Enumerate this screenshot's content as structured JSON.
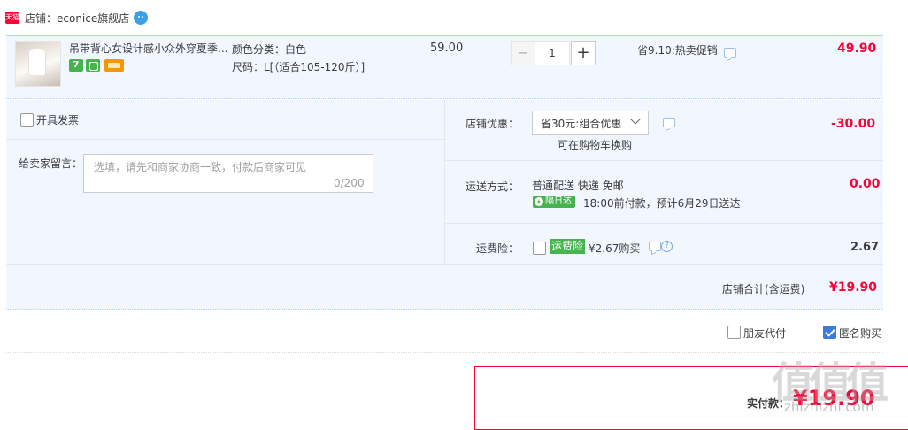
{
  "store": {
    "logo_text": "天猫",
    "name": "店铺：econice旗舰店"
  },
  "item": {
    "title": "吊带背心女设计感小众外穿夏季...",
    "badge_text": "7",
    "sku_color": "颜色分类：白色",
    "sku_size": "尺码：L[（适合105-120斤）]",
    "price": "59.00",
    "qty_minus": "−",
    "qty_value": "1",
    "qty_plus": "+",
    "promo": "省9.10:热卖促销",
    "subtotal": "49.90"
  },
  "options": {
    "invoice_label": "开具发票",
    "message_label": "给卖家留言：",
    "message_placeholder": "选填，请先和商家协商一致，付款后商家可见",
    "message_count": "0/200",
    "discount_label": "店铺优惠：",
    "discount_selected": "省30元:组合优惠",
    "discount_note": "可在购物车换购",
    "discount_amount": "-30.00",
    "shipping_label": "运送方式：",
    "shipping_method": "普通配送 快递 免邮",
    "shipping_badge": "隔日达",
    "shipping_eta": "18:00前付款，预计6月29日送达",
    "shipping_amount": "0.00",
    "insurance_label": "运费险：",
    "insurance_tag": "运费险",
    "insurance_price": "¥2.67购买",
    "insurance_amount": "2.67",
    "help_icon_text": "?",
    "store_total_label": "店铺合计(含运费)",
    "store_total": "¥19.90"
  },
  "footer": {
    "friend_pay_label": "朋友代付",
    "anonymous_label": "匿名购买",
    "anonymous_checked": true,
    "pay_label": "实付款：",
    "pay_amount": "¥19.90"
  },
  "watermark": {
    "logo": "值值值",
    "url": "zhizhizhi.com"
  },
  "colors": {
    "accent_red": "#ff0036",
    "panel_bg": "#f2f7ff",
    "border_blue": "#b2d1ff",
    "tag_green": "#47b34f",
    "check_blue": "#3a7be0"
  }
}
